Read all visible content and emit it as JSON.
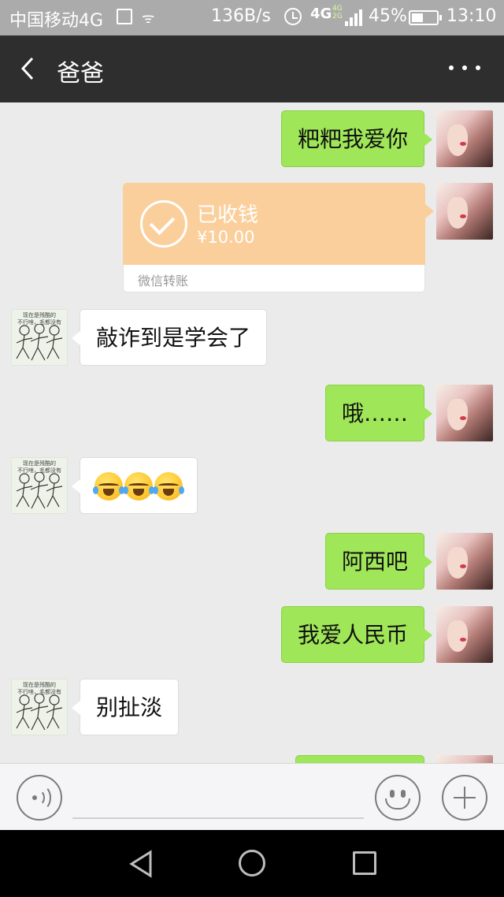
{
  "status_bar": {
    "carrier": "中国移动4G",
    "speed": "136B/s",
    "network": "4G",
    "network_alt": "4G\n2G",
    "battery": "45%",
    "time": "13:10"
  },
  "header": {
    "title": "爸爸",
    "back_icon": "chevron-left-icon",
    "more_icon": "more-dots-icon"
  },
  "messages": [
    {
      "from": "self",
      "type": "text",
      "text": "粑粑我爱你"
    },
    {
      "from": "self",
      "type": "transfer",
      "status": "已收钱",
      "amount": "¥10.00",
      "label": "微信转账"
    },
    {
      "from": "other",
      "type": "text",
      "text": "敲诈到是学会了"
    },
    {
      "from": "self",
      "type": "text",
      "text": "哦……"
    },
    {
      "from": "other",
      "type": "emoji",
      "emoji": [
        "loudly-crying-face",
        "loudly-crying-face",
        "loudly-crying-face"
      ]
    },
    {
      "from": "self",
      "type": "text",
      "text": "阿西吧"
    },
    {
      "from": "self",
      "type": "text",
      "text": "我爱人民币"
    },
    {
      "from": "other",
      "type": "text",
      "text": "别扯淡"
    }
  ],
  "other_avatar_caption": "现在是残酷的\n不行啥，毛都没有",
  "input_bar": {
    "voice_icon": "voice-icon",
    "emoji_icon": "emoji-icon",
    "plus_icon": "plus-icon"
  },
  "colors": {
    "self_bubble": "#9fe658",
    "transfer_card": "#fbcf9b",
    "nav_background": "#2e2e2e"
  }
}
